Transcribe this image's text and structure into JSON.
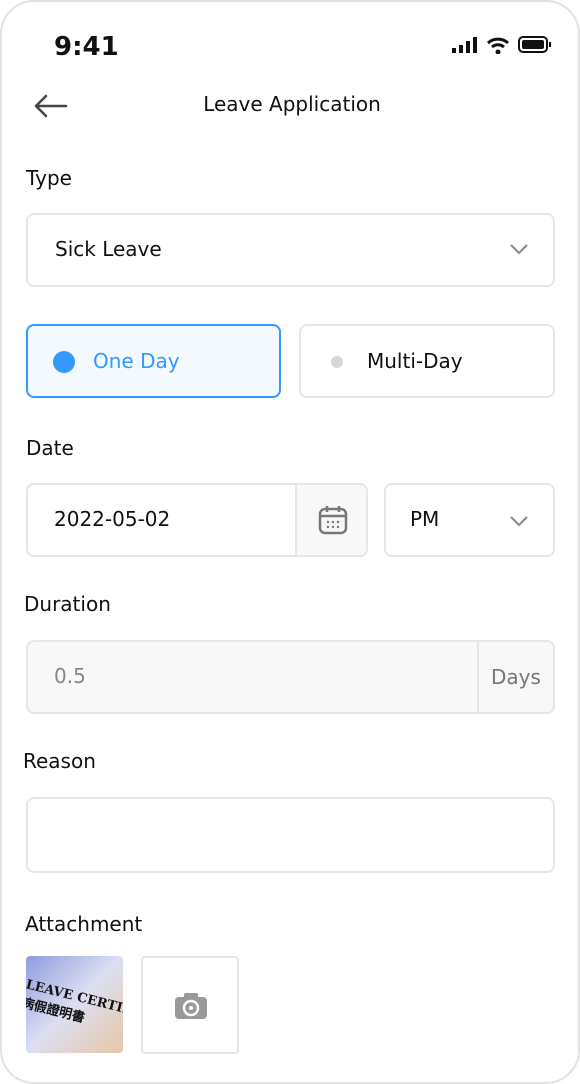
{
  "status_bar": {
    "time": "9:41"
  },
  "header": {
    "title": "Leave Application"
  },
  "form": {
    "type_label": "Type",
    "type_value": "Sick Leave",
    "option_one": "One Day",
    "option_multi": "Multi-Day",
    "selected": "One Day",
    "date_label": "Date",
    "date_value": "2022-05-02",
    "period_value": "PM",
    "duration_label": "Duration",
    "duration_value": "0.5",
    "duration_unit": "Days",
    "reason_label": "Reason",
    "reason_value": "",
    "attachment_label": "Attachment",
    "attachment_image_text": "LEAVE CERTIF 病假證明書"
  },
  "colors": {
    "accent": "#3399ff",
    "selected_bg": "#f4f9fe"
  }
}
